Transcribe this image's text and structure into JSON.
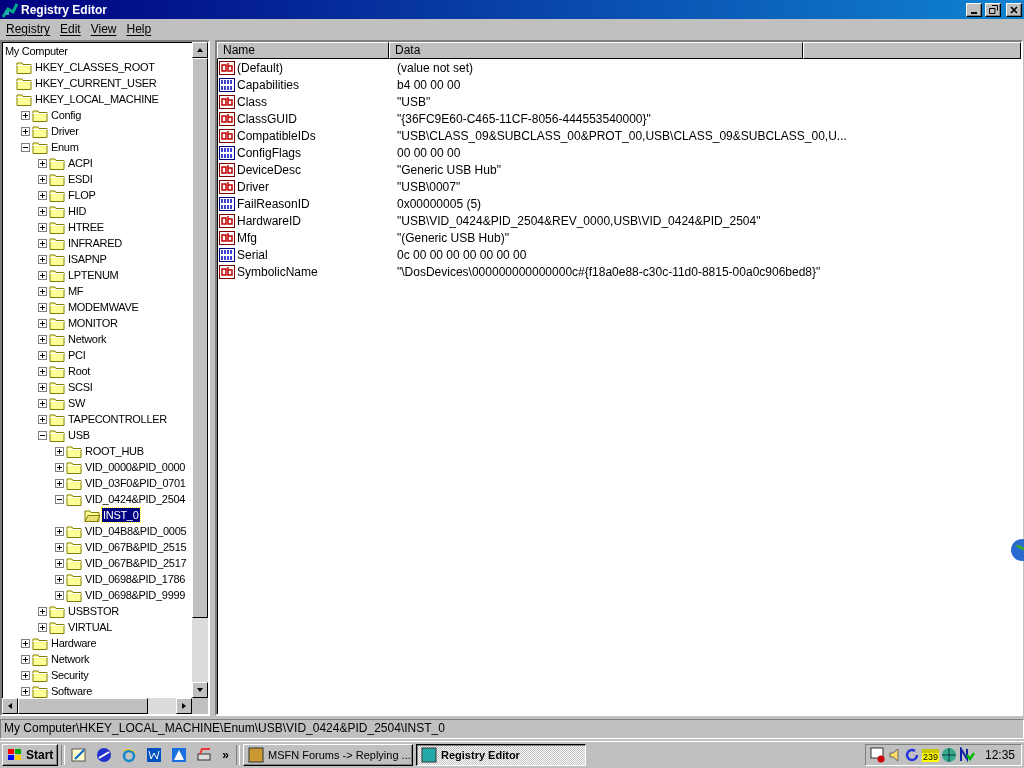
{
  "window": {
    "title": "Registry Editor"
  },
  "menu": [
    "Registry",
    "Edit",
    "View",
    "Help"
  ],
  "tree": {
    "root": "My Computer",
    "items": [
      {
        "label": "HKEY_CLASSES_ROOT",
        "selected": false
      },
      {
        "label": "HKEY_CURRENT_USER",
        "selected": false
      },
      {
        "label": "HKEY_LOCAL_MACHINE",
        "selected": false,
        "children": [
          {
            "label": "Config",
            "selected": false,
            "expanded": false
          },
          {
            "label": "Driver",
            "selected": false,
            "expanded": false
          },
          {
            "label": "Enum",
            "selected": false,
            "expanded": true,
            "children": [
              {
                "label": "ACPI",
                "selected": false,
                "expanded": false
              },
              {
                "label": "ESDI",
                "selected": false,
                "expanded": false
              },
              {
                "label": "FLOP",
                "selected": false,
                "expanded": false
              },
              {
                "label": "HID",
                "selected": false,
                "expanded": false
              },
              {
                "label": "HTREE",
                "selected": false,
                "expanded": false
              },
              {
                "label": "INFRARED",
                "selected": false,
                "expanded": false
              },
              {
                "label": "ISAPNP",
                "selected": false,
                "expanded": false
              },
              {
                "label": "LPTENUM",
                "selected": false,
                "expanded": false
              },
              {
                "label": "MF",
                "selected": false,
                "expanded": false
              },
              {
                "label": "MODEMWAVE",
                "selected": false,
                "expanded": false
              },
              {
                "label": "MONITOR",
                "selected": false,
                "expanded": false
              },
              {
                "label": "Network",
                "selected": false,
                "expanded": false
              },
              {
                "label": "PCI",
                "selected": false,
                "expanded": false
              },
              {
                "label": "Root",
                "selected": false,
                "expanded": false
              },
              {
                "label": "SCSI",
                "selected": false,
                "expanded": false
              },
              {
                "label": "SW",
                "selected": false,
                "expanded": false
              },
              {
                "label": "TAPECONTROLLER",
                "selected": false,
                "expanded": false
              },
              {
                "label": "USB",
                "selected": false,
                "expanded": true,
                "children": [
                  {
                    "label": "ROOT_HUB",
                    "selected": false,
                    "expanded": false
                  },
                  {
                    "label": "VID_0000&PID_0000",
                    "selected": false,
                    "expanded": false
                  },
                  {
                    "label": "VID_03F0&PID_0701",
                    "selected": false,
                    "expanded": false
                  },
                  {
                    "label": "VID_0424&PID_2504",
                    "selected": false,
                    "expanded": true,
                    "children": [
                      {
                        "label": "INST_0",
                        "selected": true
                      }
                    ]
                  },
                  {
                    "label": "VID_04B8&PID_0005",
                    "selected": false,
                    "expanded": false
                  },
                  {
                    "label": "VID_067B&PID_2515",
                    "selected": false,
                    "expanded": false
                  },
                  {
                    "label": "VID_067B&PID_2517",
                    "selected": false,
                    "expanded": false
                  },
                  {
                    "label": "VID_0698&PID_1786",
                    "selected": false,
                    "expanded": false
                  },
                  {
                    "label": "VID_0698&PID_9999",
                    "selected": false,
                    "expanded": false
                  }
                ]
              },
              {
                "label": "USBSTOR",
                "selected": false,
                "expanded": false
              },
              {
                "label": "VIRTUAL",
                "selected": false,
                "expanded": false
              }
            ]
          },
          {
            "label": "Hardware",
            "selected": false,
            "expanded": false
          },
          {
            "label": "Network",
            "selected": false,
            "expanded": false
          },
          {
            "label": "Security",
            "selected": false,
            "expanded": false
          },
          {
            "label": "Software",
            "selected": false,
            "expanded": false
          }
        ]
      }
    ]
  },
  "values": {
    "columns": [
      "Name",
      "Data"
    ],
    "rows": [
      {
        "kind": "string",
        "name": "(Default)",
        "data": "(value not set)"
      },
      {
        "kind": "binary",
        "name": "Capabilities",
        "data": "b4 00 00 00"
      },
      {
        "kind": "string",
        "name": "Class",
        "data": "\"USB\""
      },
      {
        "kind": "string",
        "name": "ClassGUID",
        "data": "\"{36FC9E60-C465-11CF-8056-444553540000}\""
      },
      {
        "kind": "string",
        "name": "CompatibleIDs",
        "data": "\"USB\\CLASS_09&SUBCLASS_00&PROT_00,USB\\CLASS_09&SUBCLASS_00,U..."
      },
      {
        "kind": "binary",
        "name": "ConfigFlags",
        "data": "00 00 00 00"
      },
      {
        "kind": "string",
        "name": "DeviceDesc",
        "data": "\"Generic USB Hub\""
      },
      {
        "kind": "string",
        "name": "Driver",
        "data": "\"USB\\0007\""
      },
      {
        "kind": "binary",
        "name": "FailReasonID",
        "data": "0x00000005 (5)"
      },
      {
        "kind": "string",
        "name": "HardwareID",
        "data": "\"USB\\VID_0424&PID_2504&REV_0000,USB\\VID_0424&PID_2504\""
      },
      {
        "kind": "string",
        "name": "Mfg",
        "data": "\"(Generic USB Hub)\""
      },
      {
        "kind": "binary",
        "name": "Serial",
        "data": "0c 00 00 00 00 00 00 00"
      },
      {
        "kind": "string",
        "name": "SymbolicName",
        "data": "\"\\DosDevices\\000000000000000c#{f18a0e88-c30c-11d0-8815-00a0c906bed8}\""
      }
    ]
  },
  "status_bar": "My Computer\\HKEY_LOCAL_MACHINE\\Enum\\USB\\VID_0424&PID_2504\\INST_0",
  "taskbar": {
    "start": "Start",
    "more": "»",
    "tasks": [
      {
        "label": "MSFN Forums -> Replying ...",
        "selected": false
      },
      {
        "label": "Registry Editor",
        "selected": true
      }
    ],
    "tray_badge": "239",
    "clock": "12:35"
  }
}
